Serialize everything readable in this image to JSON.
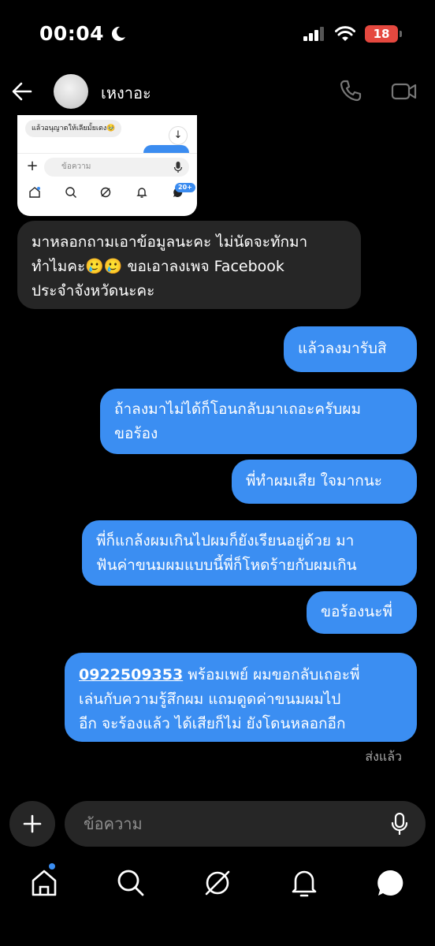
{
  "status_bar": {
    "time": "00:04",
    "battery": "18"
  },
  "header": {
    "contact_name": "เหงาอะ"
  },
  "attachment": {
    "preview_bubble_text": "แล้วอนุญาตให้เลียมั้ยเตง🥹",
    "preview_input_placeholder": "ข้อความ",
    "preview_badge": "20+"
  },
  "messages": [
    {
      "side": "in",
      "lines": [
        "มาหลอกถามเอาข้อมูลนะคะ ไม่นัดจะทักมา",
        "ทำไมคะ🥲🥲 ขอเอาลงเพจ Facebook",
        "ประจำจังหวัดนะคะ"
      ]
    },
    {
      "side": "out",
      "lines": [
        "แล้วลงมารับสิ"
      ]
    },
    {
      "side": "out",
      "lines": [
        "ถ้าลงมาไม่ได้ก็โอนกลับมาเถอะครับผม",
        "ขอร้อง"
      ]
    },
    {
      "side": "out",
      "lines": [
        "พี่ทำผมเสีย ใจมากนะ"
      ]
    },
    {
      "side": "out",
      "lines": [
        "พี่ก็แกล้งผมเกินไปผมก็ยังเรียนอยู่ด้วย มา",
        "ฟันค่าขนมผมแบบนี้พี่ก็โหดร้ายกับผมเกิน"
      ]
    },
    {
      "side": "out",
      "lines": [
        "ขอร้องนะพี่"
      ]
    },
    {
      "side": "out",
      "phone": "0922509353",
      "lines": [
        " พร้อมเพย์ ผมขอกลับเถอะพี่",
        "เล่นกับความรู้สึกผม แถมดูดค่าขนมผมไป",
        "อีก จะร้องแล้ว ได้เสียก็ไม่ ยังโดนหลอกอีก"
      ]
    }
  ],
  "seen_status": "ส่งแล้ว",
  "composer": {
    "placeholder": "ข้อความ"
  },
  "colors": {
    "outgoing_bubble": "#3b8ef2",
    "incoming_bubble": "#262626",
    "background": "#000000",
    "battery_low": "#e5483f"
  },
  "icons": {
    "header": [
      "back-arrow-icon",
      "phone-icon",
      "video-camera-icon"
    ],
    "nav": [
      "home-icon",
      "search-icon",
      "explore-icon",
      "heart-icon",
      "messages-icon"
    ]
  }
}
